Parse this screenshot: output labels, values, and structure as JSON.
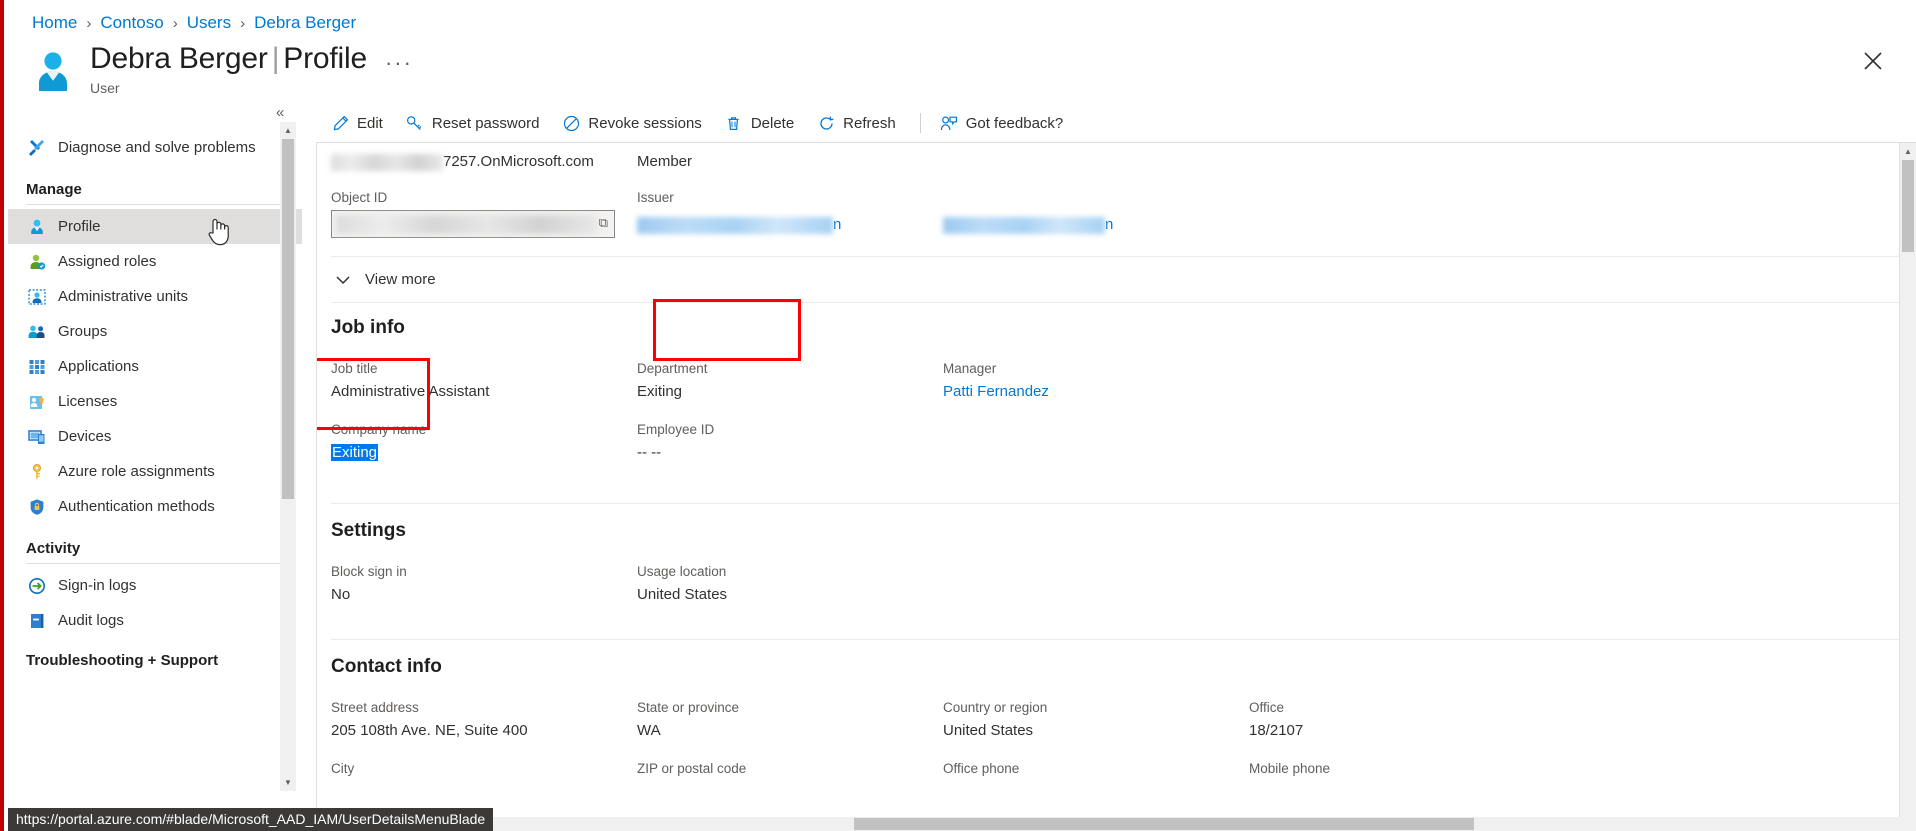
{
  "breadcrumb": {
    "items": [
      "Home",
      "Contoso",
      "Users",
      "Debra Berger"
    ],
    "separator": "›"
  },
  "header": {
    "title_name": "Debra Berger",
    "title_sep": "|",
    "title_page": "Profile",
    "subtitle": "User",
    "more_label": "···",
    "close_label": "✕",
    "avatar_icon": "user-avatar-icon"
  },
  "toolbar": {
    "items": [
      {
        "label": "Edit",
        "icon": "pencil-icon"
      },
      {
        "label": "Reset password",
        "icon": "key-icon"
      },
      {
        "label": "Revoke sessions",
        "icon": "block-circle-icon"
      },
      {
        "label": "Delete",
        "icon": "trash-icon"
      },
      {
        "label": "Refresh",
        "icon": "refresh-icon"
      }
    ],
    "feedback": {
      "label": "Got feedback?",
      "icon": "person-feedback-icon"
    }
  },
  "sidebar": {
    "collapse_label": "«",
    "top_items": [
      {
        "label": "Diagnose and solve problems",
        "icon": "wrench-screwdriver-icon",
        "selected": false
      }
    ],
    "groups": [
      {
        "title": "Manage",
        "items": [
          {
            "label": "Profile",
            "icon": "profile-person-icon",
            "selected": true
          },
          {
            "label": "Assigned roles",
            "icon": "assigned-roles-icon",
            "selected": false
          },
          {
            "label": "Administrative units",
            "icon": "administrative-units-icon",
            "selected": false
          },
          {
            "label": "Groups",
            "icon": "groups-icon",
            "selected": false
          },
          {
            "label": "Applications",
            "icon": "applications-grid-icon",
            "selected": false
          },
          {
            "label": "Licenses",
            "icon": "licenses-icon",
            "selected": false
          },
          {
            "label": "Devices",
            "icon": "devices-icon",
            "selected": false
          },
          {
            "label": "Azure role assignments",
            "icon": "key-role-icon",
            "selected": false
          },
          {
            "label": "Authentication methods",
            "icon": "shield-lock-icon",
            "selected": false
          }
        ]
      },
      {
        "title": "Activity",
        "items": [
          {
            "label": "Sign-in logs",
            "icon": "sign-in-arrow-icon",
            "selected": false
          },
          {
            "label": "Audit logs",
            "icon": "audit-book-icon",
            "selected": false
          }
        ]
      }
    ],
    "partial_group_title": "Troubleshooting + Support"
  },
  "identity": {
    "domain_suffix": "7257.OnMicrosoft.com",
    "user_type_value": "Member",
    "object_id_label": "Object ID",
    "object_id_value": "",
    "issuer_label": "Issuer",
    "issuer_value_tail": "n",
    "issuer_prefix": "M365B727257",
    "third_value_tail": "n"
  },
  "view_more": {
    "label": "View more",
    "icon": "chevron-down-icon"
  },
  "job_info": {
    "title": "Job info",
    "fields": [
      {
        "label": "Job title",
        "value": "Administrative Assistant",
        "type": "text"
      },
      {
        "label": "Department",
        "value": "Exiting",
        "type": "text",
        "highlighted": true
      },
      {
        "label": "Manager",
        "value": "Patti Fernandez",
        "type": "link"
      },
      {
        "label": "Company name",
        "value": "Exiting",
        "type": "selected",
        "highlighted": true
      },
      {
        "label": "Employee ID",
        "value": "-- --",
        "type": "text"
      }
    ]
  },
  "settings": {
    "title": "Settings",
    "fields": [
      {
        "label": "Block sign in",
        "value": "No"
      },
      {
        "label": "Usage location",
        "value": "United States"
      }
    ]
  },
  "contact_info": {
    "title": "Contact info",
    "row1": [
      {
        "label": "Street address",
        "value": "205 108th Ave. NE, Suite 400"
      },
      {
        "label": "State or province",
        "value": "WA"
      },
      {
        "label": "Country or region",
        "value": "United States"
      },
      {
        "label": "Office",
        "value": "18/2107"
      }
    ],
    "row2": [
      {
        "label": "City",
        "value": ""
      },
      {
        "label": "ZIP or postal code",
        "value": ""
      },
      {
        "label": "Office phone",
        "value": ""
      },
      {
        "label": "Mobile phone",
        "value": ""
      }
    ]
  },
  "status_bar": {
    "url": "https://portal.azure.com/#blade/Microsoft_AAD_IAM/UserDetailsMenuBlade"
  },
  "colors": {
    "accent_blue": "#0078d4",
    "annotation_red": "#ff0000",
    "selection_blue": "#0078f0",
    "selected_nav_bg": "#dfdedd",
    "border_gray": "#e1dfdd"
  }
}
